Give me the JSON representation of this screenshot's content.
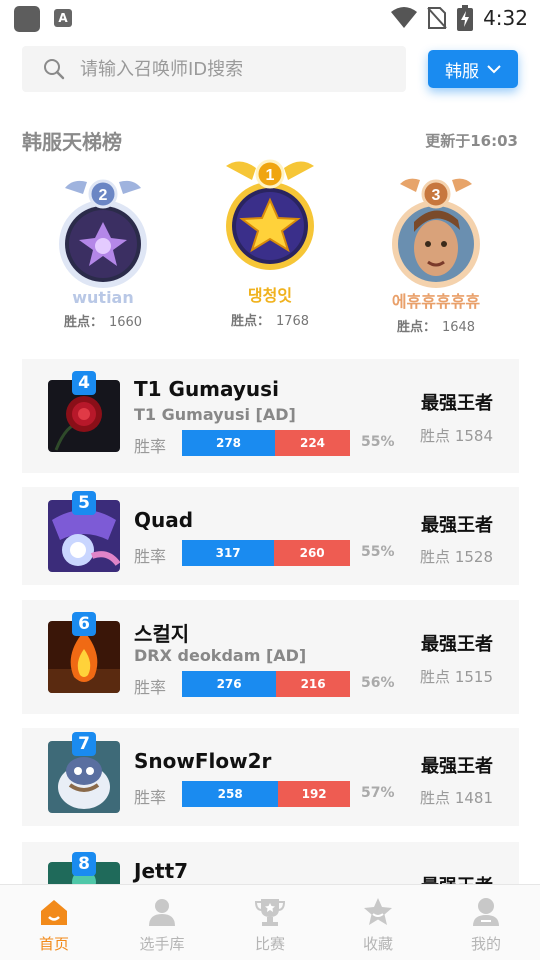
{
  "status_bar": {
    "time": "4:32",
    "app_badge": "A"
  },
  "search": {
    "placeholder": "请输入召唤师ID搜索"
  },
  "region": {
    "label": "韩服"
  },
  "ladder": {
    "title": "韩服天梯榜",
    "updated": "更新于16:03"
  },
  "podium": [
    {
      "rank": "2",
      "name": "wutian",
      "score_label": "胜点：",
      "score": "1660",
      "name_color": "#b9c8e6",
      "ring_color": "#c8d4ec",
      "badge_color": "#6b86c4",
      "avatar_theme": "purple-flower"
    },
    {
      "rank": "1",
      "name": "댕청잇",
      "score_label": "胜点：",
      "score": "1768",
      "name_color": "#f0b21e",
      "ring_color": "#f6c637",
      "badge_color": "#f0a510",
      "avatar_theme": "gold-star"
    },
    {
      "rank": "3",
      "name": "에휴휴휴휴휴",
      "score_label": "胜点：",
      "score": "1648",
      "name_color": "#e9a06a",
      "ring_color": "#f2c79b",
      "badge_color": "#c7773e",
      "avatar_theme": "portrait"
    }
  ],
  "players": [
    {
      "rank": "4",
      "name": "T1 Gumayusi",
      "sub": "T1 Gumayusi [AD]",
      "winrate_label": "胜率",
      "wins": 278,
      "losses": 224,
      "pct": "55%",
      "tier": "最强王者",
      "lp": "胜点 1584",
      "thumb_theme": "rose"
    },
    {
      "rank": "5",
      "name": "Quad",
      "sub": "",
      "winrate_label": "胜率",
      "wins": 317,
      "losses": 260,
      "pct": "55%",
      "tier": "最强王者",
      "lp": "胜点 1528",
      "thumb_theme": "orb"
    },
    {
      "rank": "6",
      "name": "스컬지",
      "sub": "DRX deokdam [AD]",
      "winrate_label": "胜率",
      "wins": 276,
      "losses": 216,
      "pct": "56%",
      "tier": "最强王者",
      "lp": "胜点 1515",
      "thumb_theme": "fire"
    },
    {
      "rank": "7",
      "name": "SnowFlow2r",
      "sub": "",
      "winrate_label": "胜率",
      "wins": 258,
      "losses": 192,
      "pct": "57%",
      "tier": "最强王者",
      "lp": "胜点 1481",
      "thumb_theme": "penguin"
    },
    {
      "rank": "8",
      "name": "Jett7",
      "sub": "",
      "winrate_label": "",
      "wins": null,
      "losses": null,
      "pct": "",
      "tier": "最强王者",
      "lp": "",
      "thumb_theme": "teal"
    }
  ],
  "tabs": [
    {
      "label": "首页",
      "icon": "home-icon",
      "active": true
    },
    {
      "label": "选手库",
      "icon": "player-icon",
      "active": false
    },
    {
      "label": "比赛",
      "icon": "trophy-icon",
      "active": false
    },
    {
      "label": "收藏",
      "icon": "star-icon",
      "active": false
    },
    {
      "label": "我的",
      "icon": "profile-icon",
      "active": false
    }
  ],
  "colors": {
    "accent": "#1a8bf0",
    "loss": "#ee5c52",
    "tab_active": "#f28a1a",
    "tab_inactive": "#c8c8c8"
  }
}
